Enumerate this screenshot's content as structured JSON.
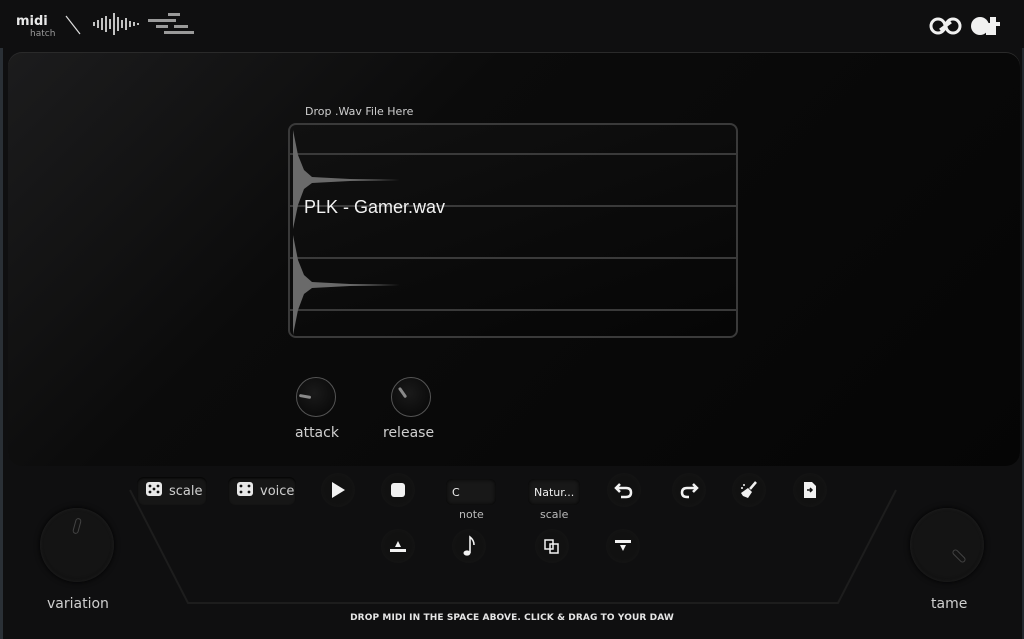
{
  "header": {
    "logo_left": "midi-hatch-logo",
    "logo_wave": "waveform-logo",
    "logo_bars": "bars-logo",
    "logo_right": "infinity-at-logo"
  },
  "sample": {
    "drop_label": "Drop .Wav File Here",
    "file_name": "PLK - Gamer.wav"
  },
  "envelope": {
    "attack": {
      "label": "attack",
      "value": 0.05
    },
    "release": {
      "label": "release",
      "value": 0.3
    }
  },
  "toolbar": {
    "scale_dice_label": "scale",
    "voice_dice_label": "voice",
    "play_icon": "play-icon",
    "stop_icon": "stop-icon",
    "note_value": "C",
    "note_label": "note",
    "scale_value": "Natur...",
    "scale_label": "scale",
    "undo_icon": "undo-icon",
    "redo_icon": "redo-icon",
    "clear_icon": "broom-icon",
    "export_icon": "file-export-icon",
    "octave_up_icon": "octave-up-icon",
    "note_icon": "music-note-icon",
    "duplicate_icon": "duplicate-icon",
    "octave_down_icon": "octave-down-icon"
  },
  "macros": {
    "variation": {
      "label": "variation",
      "value": 0.55
    },
    "tame": {
      "label": "tame",
      "value": 0.85
    }
  },
  "footer": {
    "hint": "DROP MIDI IN THE SPACE ABOVE. CLICK & DRAG TO YOUR DAW"
  }
}
